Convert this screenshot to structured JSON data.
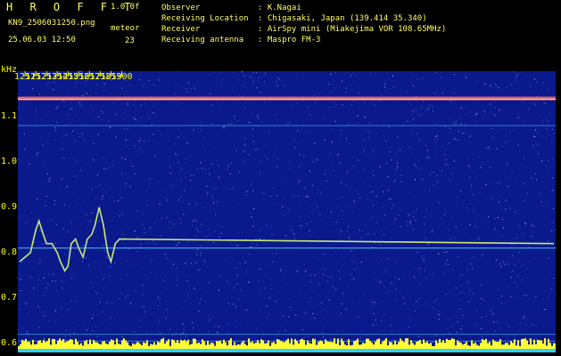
{
  "header": {
    "title": "H R O F F T",
    "version": "1.0.0f",
    "filename": "KN9_2506031250.png",
    "mode": "meteor",
    "datetime": "25.06.03 12:50",
    "count": "23"
  },
  "info": [
    {
      "label": "Observer",
      "value": ": K.Nagai"
    },
    {
      "label": "Receiving Location",
      "value": ": Chigasaki, Japan (139.414 35.340)"
    },
    {
      "label": "Receiver",
      "value": ": AirSpy mini (Miakejima VOR 108.65MHz)"
    },
    {
      "label": "Receiving antenna",
      "value": ": Maspro FM-3"
    }
  ],
  "chart_data": {
    "type": "heatmap",
    "ylabel": "kHz",
    "y_ticks": [
      "0.6",
      "0.7",
      "0.8",
      "0.9",
      "1.0",
      "1.1"
    ],
    "ylim": [
      0.58,
      1.2
    ],
    "x_ticks": [
      "1251",
      "1252",
      "1253",
      "1254",
      "1255",
      "1256",
      "1257",
      "1258",
      "1259",
      "1300"
    ],
    "xlim": [
      1250.5,
      1300.2
    ],
    "reference_lines_khz": [
      1.14,
      1.08,
      0.81,
      0.62,
      0.605
    ],
    "trace": {
      "x": [
        1250.5,
        1251.0,
        1251.5,
        1252.0,
        1252.3,
        1252.7,
        1253.0,
        1253.5,
        1254.0,
        1254.3,
        1254.7,
        1255.0,
        1255.3,
        1255.7,
        1256.0,
        1256.4,
        1256.8,
        1257.2,
        1257.5,
        1257.9,
        1258.3,
        1258.7,
        1259.0,
        1259.4,
        1259.8,
        1300.2
      ],
      "y": [
        0.78,
        0.79,
        0.8,
        0.85,
        0.87,
        0.84,
        0.82,
        0.82,
        0.8,
        0.78,
        0.76,
        0.77,
        0.82,
        0.83,
        0.81,
        0.79,
        0.83,
        0.84,
        0.86,
        0.9,
        0.86,
        0.8,
        0.78,
        0.82,
        0.83,
        0.82
      ]
    },
    "colors": {
      "background": "#0a1a8c",
      "trace": "#c8e878",
      "signal_band": "#ff7070",
      "baseline": "#ffff33",
      "gridline": "#5ac8ff"
    }
  }
}
